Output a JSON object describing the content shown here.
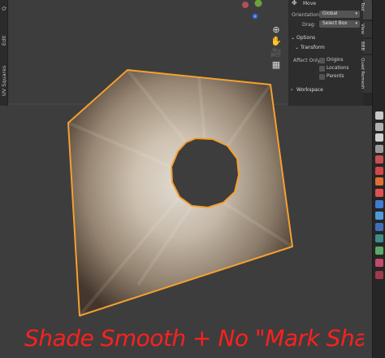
{
  "left_tabs": [
    "Q",
    "UV Squares",
    "Edit"
  ],
  "npanel": {
    "header": "Move",
    "orientation_label": "Orientation",
    "orientation_value": "Global",
    "drag_label": "Drag:",
    "drag_value": "Select Box",
    "options_label": "Options",
    "transform_label": "Transform",
    "affect_only_label": "Affect Only",
    "checks": [
      "Origins",
      "Locations",
      "Parents"
    ],
    "workspace_label": "Workspace"
  },
  "right_tabs": [
    "Tool",
    "View",
    "BBB",
    "Quad Remesh"
  ],
  "annotation": "Shade Smooth + No \"Mark Sharp\"",
  "colors": {
    "viewport_bg": "#3d3d3d",
    "selection_outline": "#f5a030",
    "annotation_red": "#ff2020"
  },
  "icons": [
    "grab-hand-icon",
    "camera-icon",
    "grid-icon",
    "zoom-icon",
    "gizmo-axis-icon"
  ]
}
